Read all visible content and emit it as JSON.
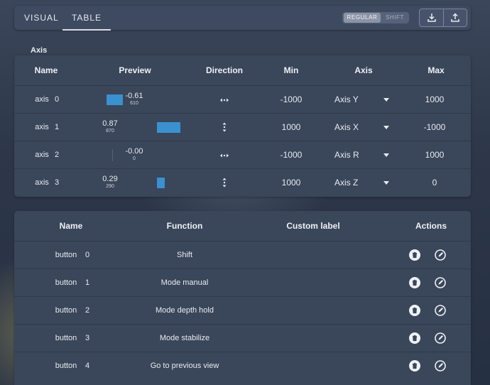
{
  "tabs": [
    {
      "label": "VISUAL"
    },
    {
      "label": "TABLE",
      "active": true
    }
  ],
  "mode_toggle": {
    "regular": "REGULAR",
    "shift": "SHIFT",
    "selected": "REGULAR"
  },
  "axis_section": {
    "title": "Axis",
    "headers": {
      "name": "Name",
      "preview": "Preview",
      "direction": "Direction",
      "min": "Min",
      "axis": "Axis",
      "max": "Max"
    },
    "rows": [
      {
        "name": "axis",
        "index": "0",
        "value": "-0.61",
        "raw": "610",
        "level": -0.61,
        "direction": "horizontal",
        "min": "-1000",
        "axis": "Axis Y",
        "max": "1000"
      },
      {
        "name": "axis",
        "index": "1",
        "value": "0.87",
        "raw": "870",
        "level": 0.87,
        "direction": "vertical",
        "min": "1000",
        "axis": "Axis X",
        "max": "-1000"
      },
      {
        "name": "axis",
        "index": "2",
        "value": "-0.00",
        "raw": "0",
        "level": 0,
        "direction": "horizontal",
        "min": "-1000",
        "axis": "Axis R",
        "max": "1000"
      },
      {
        "name": "axis",
        "index": "3",
        "value": "0.29",
        "raw": "290",
        "level": 0.29,
        "direction": "vertical",
        "min": "1000",
        "axis": "Axis Z",
        "max": "0"
      }
    ]
  },
  "button_section": {
    "headers": {
      "name": "Name",
      "function": "Function",
      "custom_label": "Custom label",
      "actions": "Actions"
    },
    "rows": [
      {
        "name": "button",
        "index": "0",
        "function": "Shift",
        "custom_label": ""
      },
      {
        "name": "button",
        "index": "1",
        "function": "Mode manual",
        "custom_label": ""
      },
      {
        "name": "button",
        "index": "2",
        "function": "Mode depth hold",
        "custom_label": ""
      },
      {
        "name": "button",
        "index": "3",
        "function": "Mode stabilize",
        "custom_label": ""
      },
      {
        "name": "button",
        "index": "4",
        "function": "Go to previous view",
        "custom_label": ""
      }
    ]
  },
  "icons": {
    "download": "download-icon",
    "upload": "upload-icon",
    "direction_horizontal": "arrows-horizontal-icon",
    "direction_vertical": "arrows-vertical-icon",
    "dropdown": "chevron-down-icon",
    "delete": "trash-icon",
    "edit": "edit-icon"
  },
  "colors": {
    "accent_bar": "#3a91d0",
    "panel": "#3a4659",
    "background": "#2d3749"
  }
}
